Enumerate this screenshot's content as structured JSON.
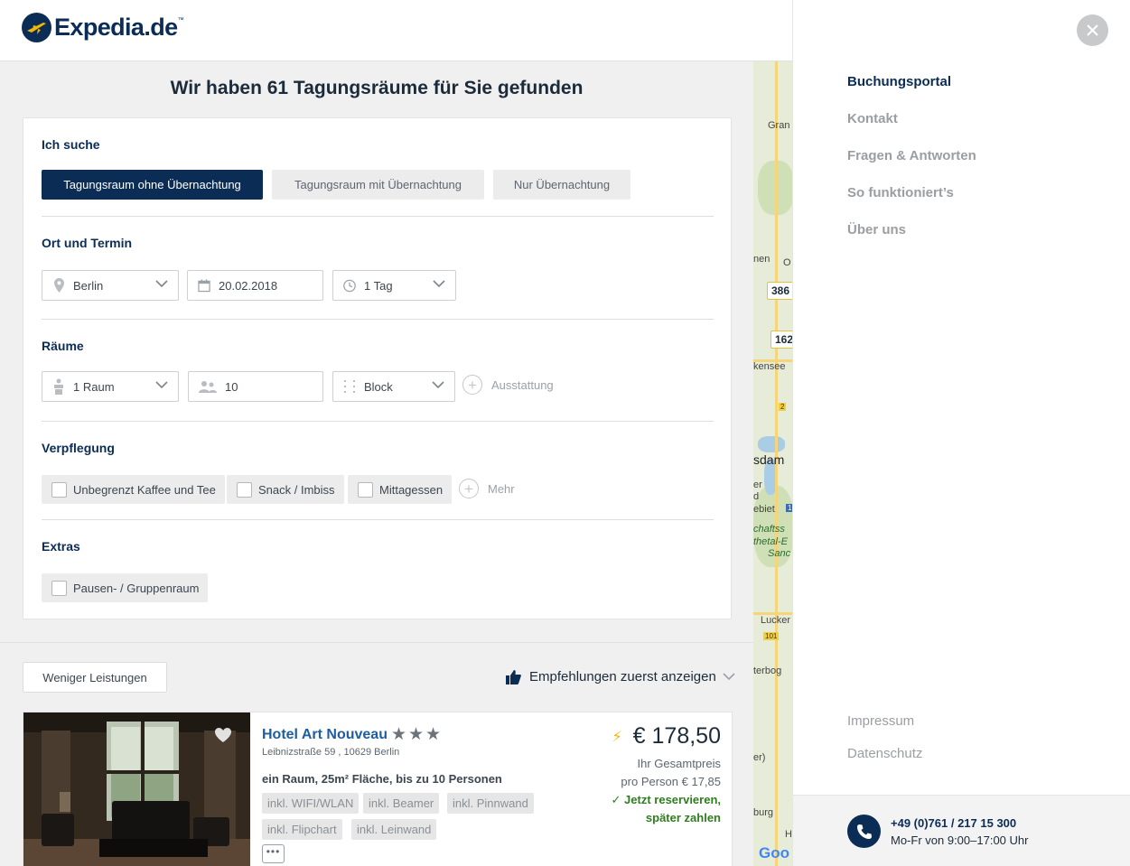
{
  "brand": {
    "name": "Expedia.de",
    "tm": "™"
  },
  "results": {
    "prefix": "Wir haben ",
    "count": "61 Tagungsräume",
    "suffix": " für Sie gefunden"
  },
  "search": {
    "section_type": "Ich suche",
    "types": [
      {
        "label": "Tagungsraum ohne Übernachtung",
        "selected": true
      },
      {
        "label": "Tagungsraum mit Übernachtung",
        "selected": false
      },
      {
        "label": "Nur Übernachtung",
        "selected": false
      }
    ],
    "section_location": "Ort und Termin",
    "city": "Berlin",
    "date": "20.02.2018",
    "duration": "1 Tag",
    "section_rooms": "Räume",
    "rooms": "1 Raum",
    "persons": "10",
    "seating": "Block",
    "equipment_label": "Ausstattung",
    "section_catering": "Verpflegung",
    "catering": [
      "Unbegrenzt Kaffee und Tee",
      "Snack / Imbiss",
      "Mittagessen"
    ],
    "catering_more": "Mehr",
    "section_extras": "Extras",
    "extras": [
      "Pausen- / Gruppenraum"
    ]
  },
  "list": {
    "less_services": "Weniger Leistungen",
    "sort_label": "Empfehlungen zuerst anzeigen"
  },
  "hotel": {
    "name": "Hotel Art Nouveau",
    "stars": "★★★",
    "address": "Leibnizstraße 59 , 10629 Berlin",
    "description": "ein Raum, 25m² Fläche, bis zu 10 Personen",
    "tags": [
      "inkl. WIFI/WLAN",
      "inkl. Beamer",
      "inkl. Pinnwand",
      "inkl. Flipchart",
      "inkl. Leinwand"
    ],
    "more": "•••",
    "price": "€ 178,50",
    "total_label": "Ihr Gesamtpreis",
    "per_person": "pro Person € 17,85",
    "reserve_line1": "Jetzt reservieren,",
    "reserve_line2": "später zahlen"
  },
  "map": {
    "labels": [
      "Gran",
      "nen",
      "O",
      "kensee",
      "sdam",
      "er",
      "d",
      "ebiet",
      "chaftss",
      "thetal-E",
      "Sanc",
      "Lucker",
      "terbog",
      "er)",
      "burg",
      "H"
    ],
    "pins": [
      "386",
      "162"
    ],
    "shields": [
      "2",
      "1",
      "101"
    ],
    "google": "Goo"
  },
  "panel": {
    "nav": [
      {
        "label": "Buchungsportal",
        "active": true
      },
      {
        "label": "Kontakt",
        "active": false
      },
      {
        "label": "Fragen & Antworten",
        "active": false
      },
      {
        "label": "So funktioniert’s",
        "active": false
      },
      {
        "label": "Über uns",
        "active": false
      }
    ],
    "imprint": "Impressum",
    "privacy": "Datenschutz",
    "phone": "+49 (0)761 / 217 15 300",
    "hours": "Mo-Fr von 9:00–17:00 Uhr"
  },
  "colors": {
    "brand_navy": "#0b2c55",
    "link_blue": "#1f5d9e",
    "success_green": "#2f7d1e",
    "bolt_yellow": "#f2b705"
  }
}
